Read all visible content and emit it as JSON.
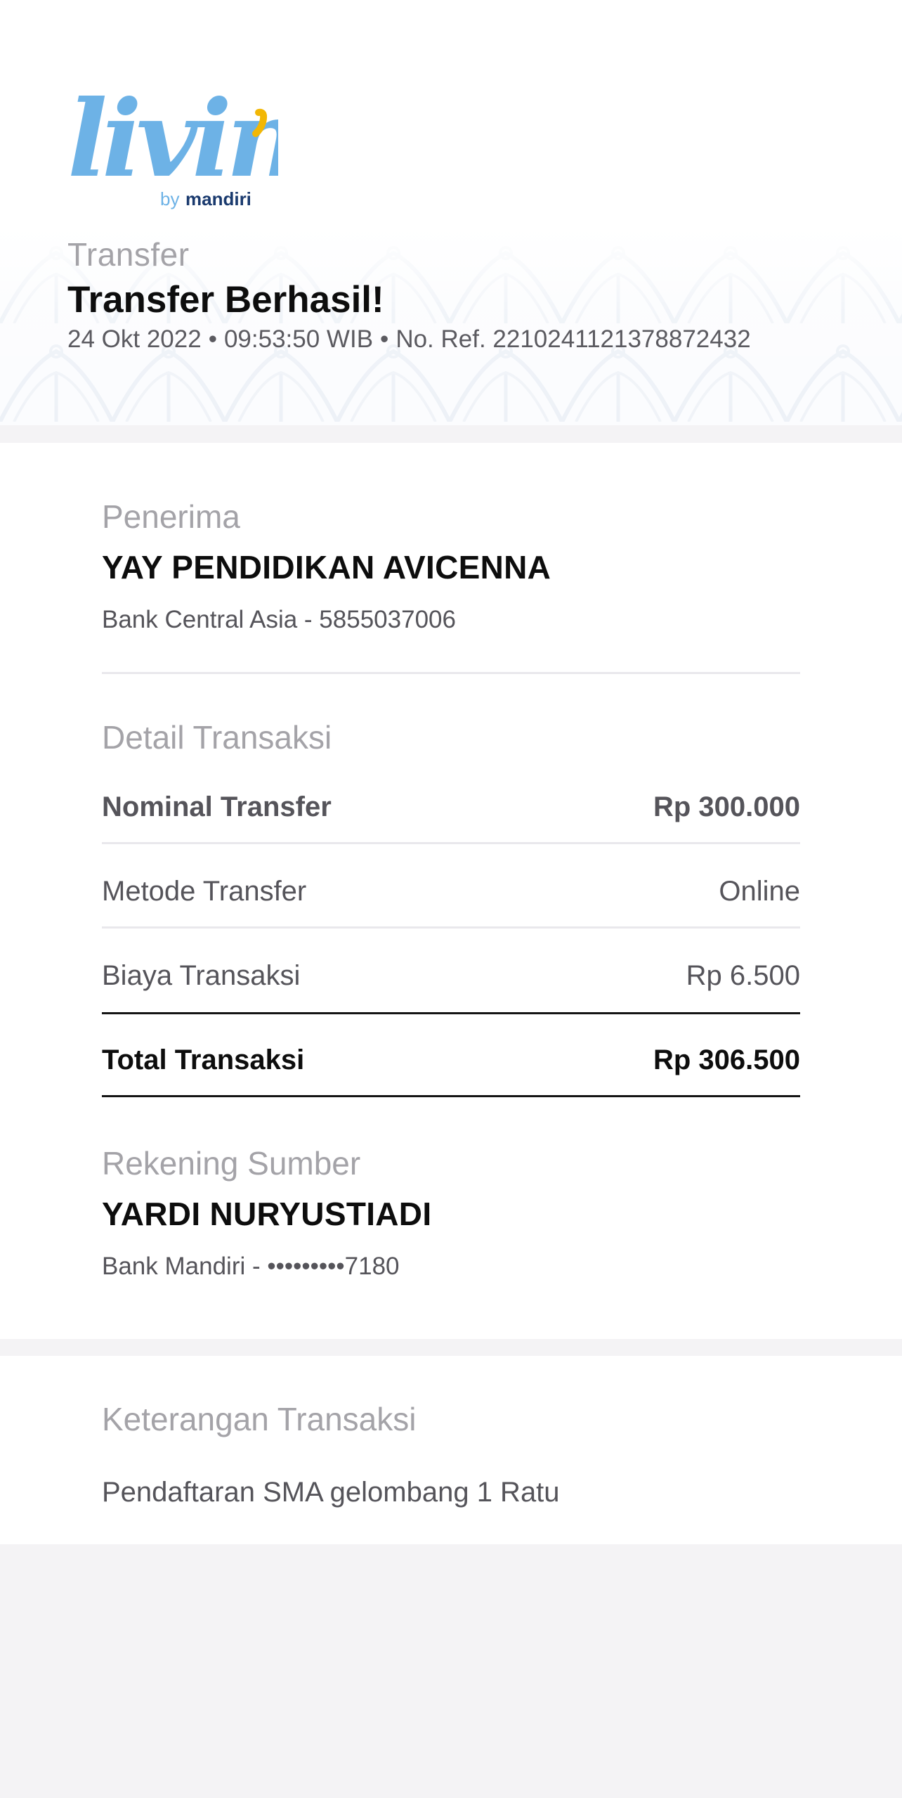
{
  "header": {
    "logo_text": "livin'",
    "logo_byline_prefix": "by",
    "logo_byline_brand": "mandiri",
    "label": "Transfer",
    "title": "Transfer Berhasil!",
    "date": "24 Okt 2022",
    "time": "09:53:50 WIB",
    "ref": "No. Ref. 2210241121378872432",
    "separator": "•"
  },
  "recipient": {
    "section_label": "Penerima",
    "name": "YAY PENDIDIKAN AVICENNA",
    "account": "Bank Central Asia - 5855037006"
  },
  "details": {
    "section_label": "Detail Transaksi",
    "rows": [
      {
        "label": "Nominal Transfer",
        "value": "Rp 300.000"
      },
      {
        "label": "Metode Transfer",
        "value": "Online"
      },
      {
        "label": "Biaya Transaksi",
        "value": "Rp 6.500"
      }
    ],
    "total": {
      "label": "Total Transaksi",
      "value": "Rp 306.500"
    }
  },
  "source": {
    "section_label": "Rekening Sumber",
    "name": "YARDI NURYUSTIADI",
    "account": "Bank Mandiri - •••••••••7180"
  },
  "notes": {
    "section_label": "Keterangan Transaksi",
    "text": "Pendaftaran SMA gelombang 1 Ratu"
  },
  "colors": {
    "logo_blue": "#6db2e6",
    "logo_yellow": "#f2b705",
    "brand_navy": "#1a3a6e",
    "label_gray": "#a4a3a8",
    "text_gray": "#55545a",
    "background": "#f4f3f5"
  }
}
